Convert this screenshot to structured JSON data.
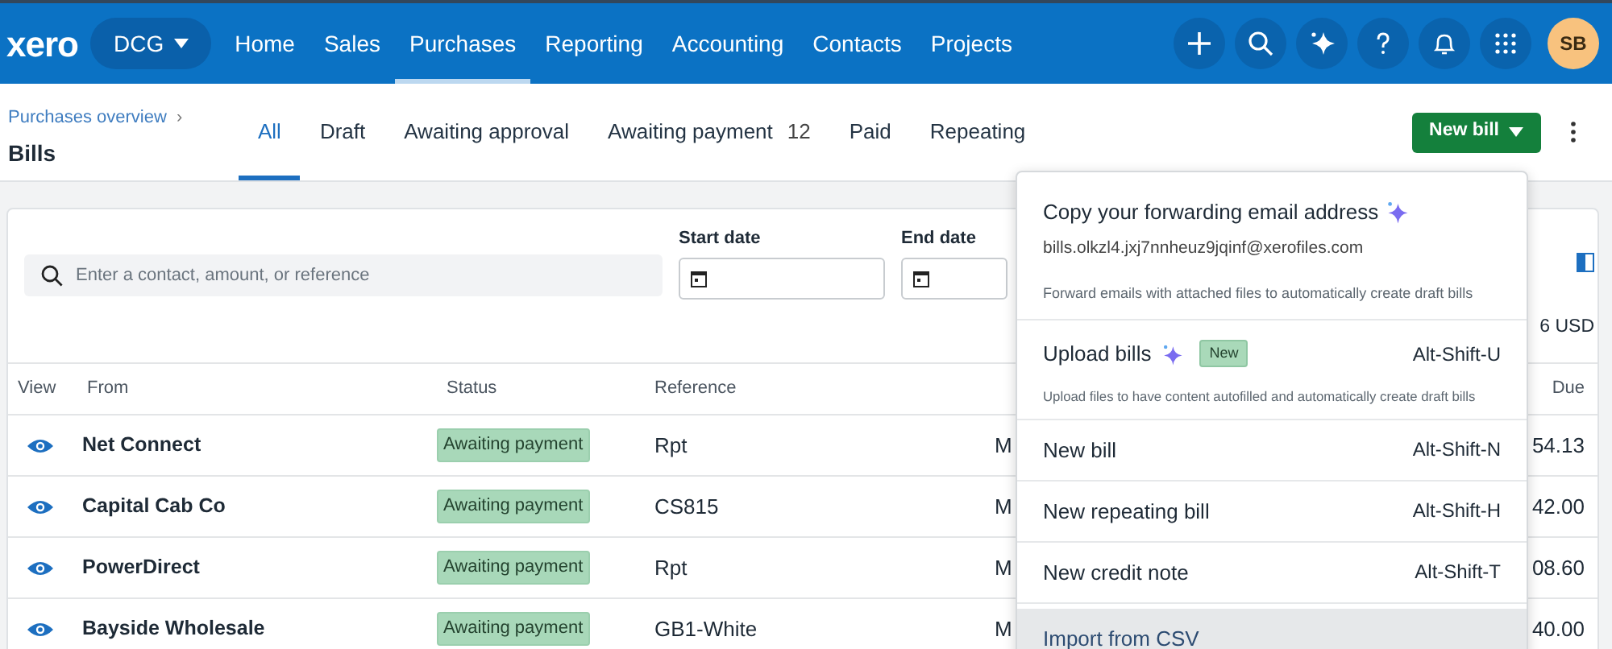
{
  "nav": {
    "logo": "xero",
    "org": "DCG",
    "items": [
      {
        "label": "Home",
        "selected": false
      },
      {
        "label": "Sales",
        "selected": false
      },
      {
        "label": "Purchases",
        "selected": true
      },
      {
        "label": "Reporting",
        "selected": false
      },
      {
        "label": "Accounting",
        "selected": false
      },
      {
        "label": "Contacts",
        "selected": false
      },
      {
        "label": "Projects",
        "selected": false
      }
    ],
    "avatar": "SB"
  },
  "header": {
    "breadcrumb": "Purchases overview",
    "breadcrumb_separator": "›",
    "title": "Bills",
    "tabs": [
      {
        "label": "All",
        "selected": true
      },
      {
        "label": "Draft",
        "selected": false
      },
      {
        "label": "Awaiting approval",
        "selected": false
      },
      {
        "label": "Awaiting payment",
        "count": "12",
        "selected": false
      },
      {
        "label": "Paid",
        "selected": false
      },
      {
        "label": "Repeating",
        "selected": false
      }
    ],
    "new_bill_button": "New bill"
  },
  "filters": {
    "search_placeholder": "Enter a contact, amount, or reference",
    "start_date_label": "Start date",
    "end_date_label": "End date",
    "total": "6 USD"
  },
  "table": {
    "columns": [
      "View",
      "From",
      "Status",
      "Reference",
      "Due"
    ],
    "rows": [
      {
        "from": "Net Connect",
        "status": "Awaiting payment",
        "reference": "Rpt",
        "column_5": "M",
        "due": "54.13"
      },
      {
        "from": "Capital Cab Co",
        "status": "Awaiting payment",
        "reference": "CS815",
        "column_5": "M",
        "due": "42.00"
      },
      {
        "from": "PowerDirect",
        "status": "Awaiting payment",
        "reference": "Rpt",
        "column_5": "M",
        "due": "08.60"
      },
      {
        "from": "Bayside Wholesale",
        "status": "Awaiting payment",
        "reference": "GB1-White",
        "column_5": "M",
        "due": "40.00"
      }
    ]
  },
  "menu": {
    "items": [
      {
        "kind": "email",
        "title": "Copy your forwarding email address",
        "email": "bills.olkzl4.jxj7nnheuz9jqinf@xerofiles.com",
        "hint": "Forward emails with attached files to automatically create draft bills"
      },
      {
        "kind": "upload",
        "title": "Upload bills",
        "badge": "New",
        "shortcut": "Alt-Shift-U",
        "hint": "Upload files to have content autofilled and automatically create draft bills"
      },
      {
        "kind": "action",
        "label": "New bill",
        "shortcut": "Alt-Shift-N",
        "selected": false
      },
      {
        "kind": "action",
        "label": "New repeating bill",
        "shortcut": "Alt-Shift-H",
        "selected": false
      },
      {
        "kind": "action",
        "label": "New credit note",
        "shortcut": "Alt-Shift-T",
        "selected": false
      },
      {
        "kind": "action",
        "label": "Import from CSV",
        "selected": true
      }
    ]
  }
}
